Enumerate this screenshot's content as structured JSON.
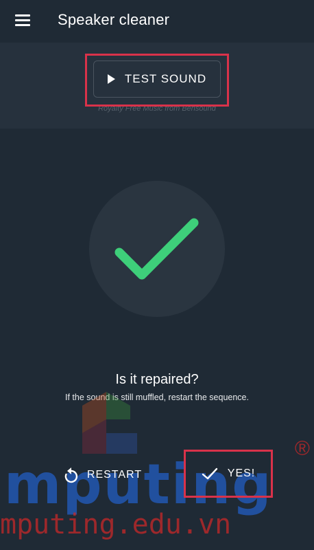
{
  "app": {
    "title": "Speaker cleaner"
  },
  "test_sound": {
    "label": "TEST SOUND",
    "credit": "Royalty Free Music from Bensound"
  },
  "status": {
    "question": "Is it repaired?",
    "hint": "If the sound is still muffled, restart the sequence."
  },
  "actions": {
    "restart_label": "RESTART",
    "yes_label": "YES!"
  },
  "watermark": {
    "text": "mputing",
    "domain": "mputing.edu.vn",
    "registered": "®"
  },
  "colors": {
    "accent_green": "#3ecf7a",
    "highlight_red": "#d9324a",
    "background": "#1f2a35"
  },
  "icons": [
    "menu-icon",
    "play-icon",
    "checkmark-icon",
    "restart-icon",
    "check-icon"
  ]
}
